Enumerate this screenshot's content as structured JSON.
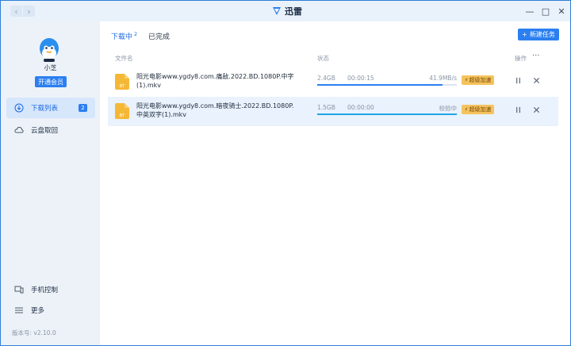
{
  "titlebar": {
    "back": "‹",
    "forward": "›",
    "app_title": "迅雷",
    "minimize": "—",
    "maximize": "□",
    "close": "✕"
  },
  "user": {
    "name": "小芝",
    "vip_button": "开通会员"
  },
  "sidebar": {
    "items": [
      {
        "label": "下载列表",
        "icon": "download-list-icon",
        "badge": "2",
        "active": true
      },
      {
        "label": "云盘取回",
        "icon": "cloud-icon"
      },
      {
        "label": "手机控制",
        "icon": "phone-control-icon"
      },
      {
        "label": "更多",
        "icon": "menu-icon"
      }
    ],
    "version": "版本号: v2.10.0"
  },
  "tabs": [
    {
      "label": "下载中",
      "count": "2",
      "active": true
    },
    {
      "label": "已完成"
    }
  ],
  "new_task_button": "新建任务",
  "table": {
    "columns": {
      "name": "文件名",
      "status": "状态",
      "actions": "操作",
      "more": "···"
    }
  },
  "downloads": [
    {
      "name": "阳光电影www.ygdy8.com.痛敌.2022.BD.1080P.中字(1).mkv",
      "size": "2.4GB",
      "time": "00:00:15",
      "speed": "41.9MB/s",
      "progress": 0.9,
      "accel_label": "超级加速",
      "file_type": "BT",
      "selected": false
    },
    {
      "name": "阳光电影www.ygdy8.com.暗夜骑士.2022.BD.1080P.中英双字(1).mkv",
      "size": "1.5GB",
      "time": "00:00:00",
      "speed": "校验中",
      "progress": 1.0,
      "accel_label": "超级加速",
      "file_type": "BT",
      "selected": true
    }
  ],
  "colors": {
    "accent": "#2b7ff0",
    "accel_badge": "#f5c35e",
    "selected_row": "#e9f2fd"
  }
}
